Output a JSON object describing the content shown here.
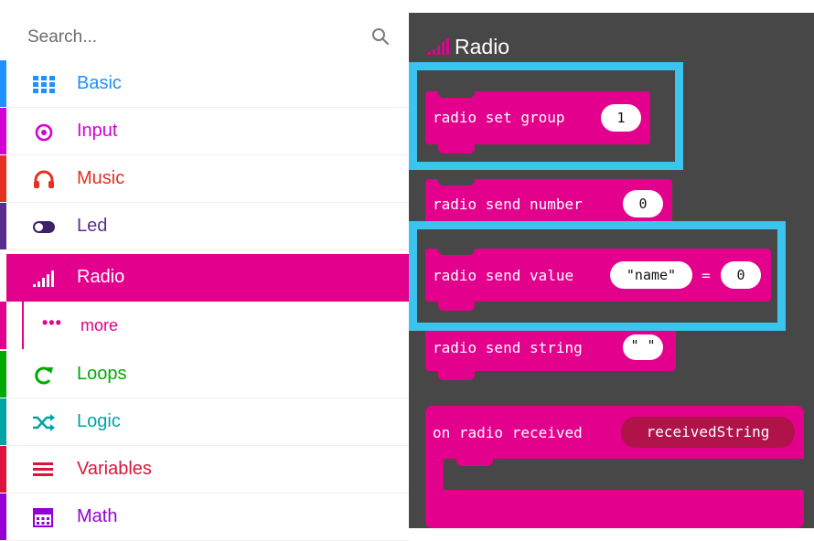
{
  "search": {
    "placeholder": "Search..."
  },
  "categories": [
    {
      "label": "Basic",
      "color": "#1e90ff",
      "icon": "grid-icon"
    },
    {
      "label": "Input",
      "color": "#d400d4",
      "icon": "target-icon"
    },
    {
      "label": "Music",
      "color": "#e63022",
      "icon": "headphones-icon"
    },
    {
      "label": "Led",
      "color": "#5c2d91",
      "icon": "toggle-icon"
    },
    {
      "label": "Radio",
      "color": "#e3008c",
      "icon": "signal-bars-icon",
      "selected": true
    },
    {
      "label": "Loops",
      "color": "#00aa00",
      "icon": "loop-icon"
    },
    {
      "label": "Logic",
      "color": "#00a4a6",
      "icon": "shuffle-icon"
    },
    {
      "label": "Variables",
      "color": "#dc143c",
      "icon": "lines-icon"
    },
    {
      "label": "Math",
      "color": "#9400d3",
      "icon": "calculator-icon"
    }
  ],
  "more": {
    "label": "more",
    "dots": "•••"
  },
  "flyout": {
    "title": "Radio",
    "blocks": [
      {
        "text": "radio set group",
        "input": "1"
      },
      {
        "text": "radio send number",
        "input": "0"
      },
      {
        "text": "radio send value",
        "input_name": "\"name\"",
        "equals": "=",
        "input": "0"
      },
      {
        "text": "radio send string",
        "input": "\" \""
      },
      {
        "text": "on radio received",
        "input": "receivedString"
      }
    ]
  },
  "colors": {
    "accent": "#e3008c",
    "flyout_bg": "#474747",
    "highlight": "#3bc4ee"
  }
}
